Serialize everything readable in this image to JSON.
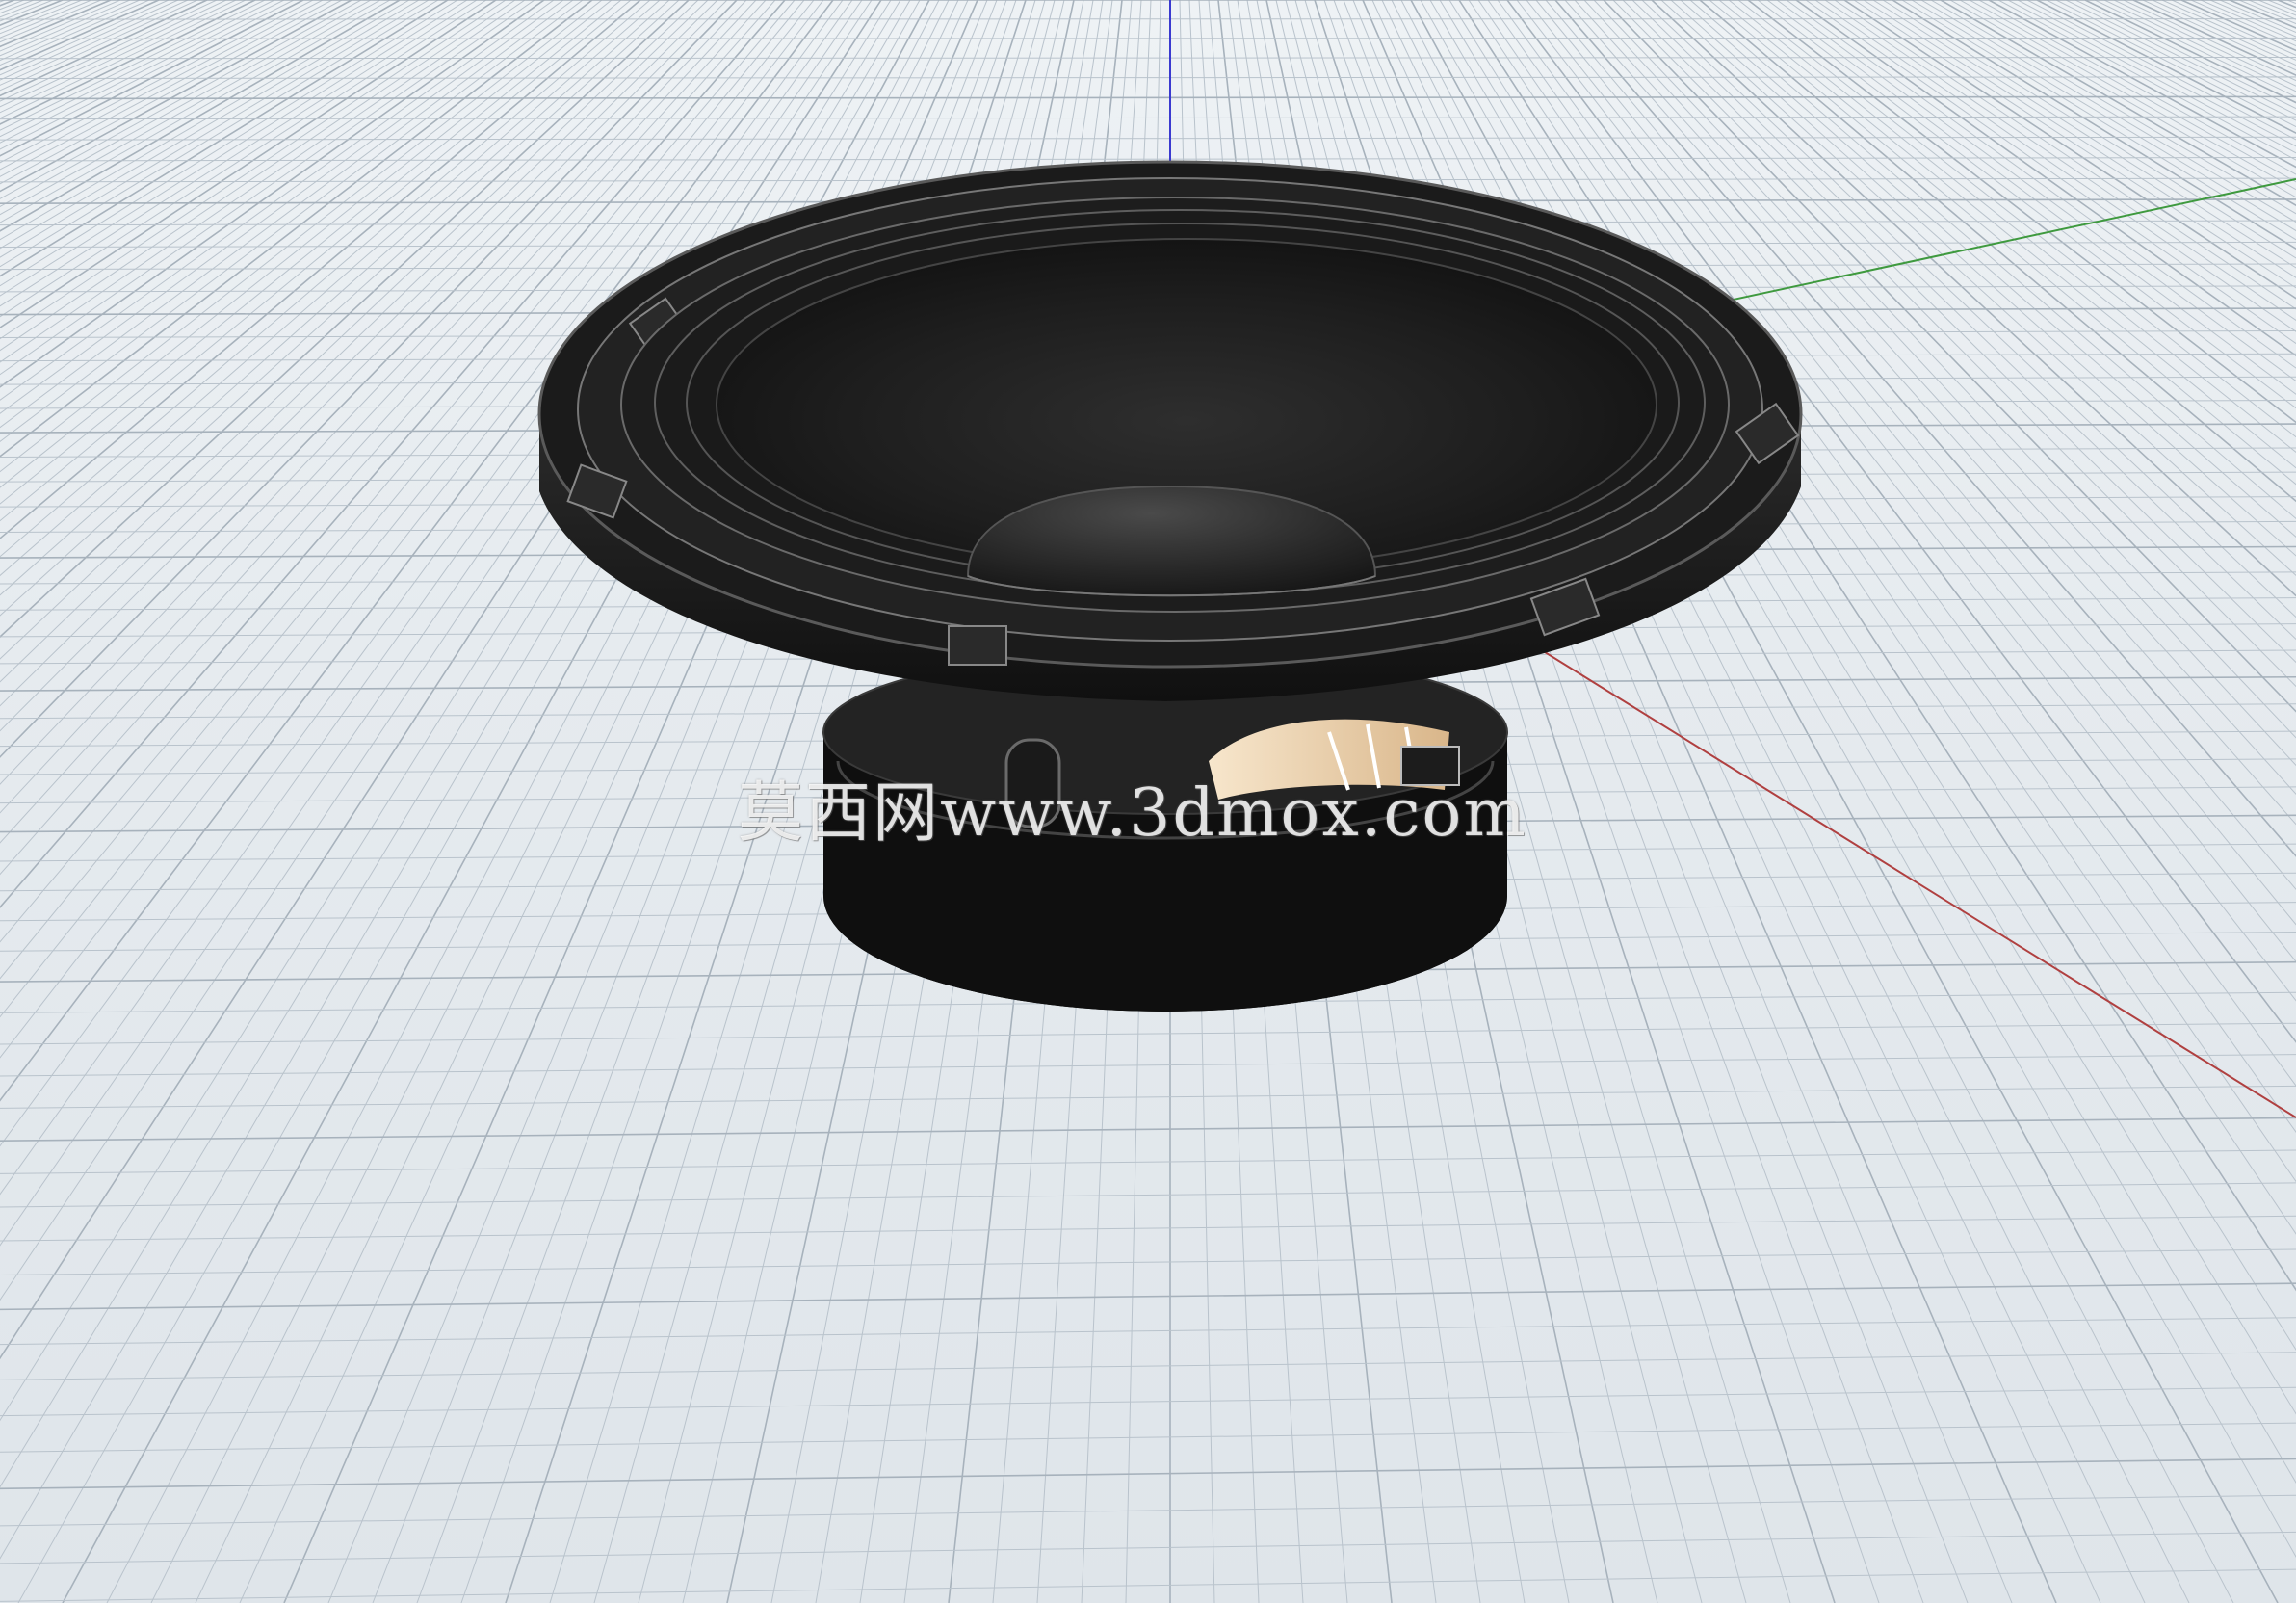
{
  "viewport": {
    "background": "#e6ebef",
    "grid_color": "#b9c3cc",
    "grid_major_color": "#a7b2bc"
  },
  "axes": {
    "x_color": "#b04040",
    "y_color": "#3f9a3f",
    "z_color": "#3a3ad0"
  },
  "model": {
    "icon": "speaker-woofer-icon",
    "body_color": "#1a1a1a",
    "highlight_color": "#4a4a4a",
    "coil_color": "#efd6b4"
  },
  "watermark": {
    "text": "莫西网www.3dmox.com"
  }
}
